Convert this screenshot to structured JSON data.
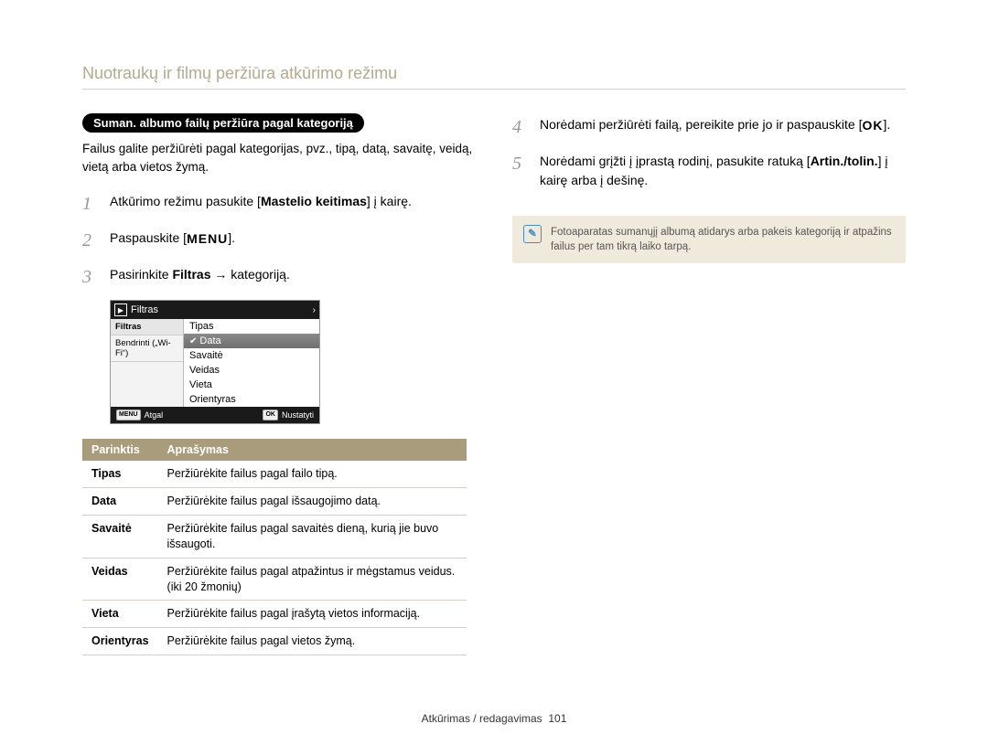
{
  "page_title": "Nuotraukų ir filmų peržiūra atkūrimo režimu",
  "pill": "Suman. albumo failų peržiūra pagal kategoriją",
  "intro": "Failus galite peržiūrėti pagal kategorijas, pvz., tipą, datą, savaitę, veidą, vietą arba vietos žymą.",
  "steps_left": {
    "s1_pre": "Atkūrimo režimu pasukite [",
    "s1_bold": "Mastelio keitimas",
    "s1_post": "] į kairę.",
    "s2_pre": "Paspauskite [",
    "s2_label": "MENU",
    "s2_post": "].",
    "s3_pre": "Pasirinkite ",
    "s3_bold": "Filtras",
    "s3_post": " → kategoriją."
  },
  "steps_right": {
    "s4_pre": "Norėdami peržiūrėti failą, pereikite prie jo ir paspauskite [",
    "s4_label": "OK",
    "s4_post": "].",
    "s5_pre": "Norėdami grįžti į įprastą rodinį, pasukite ratuką [",
    "s5_bold": "Artin./tolin.",
    "s5_post": "] į kairę arba į dešinę."
  },
  "device": {
    "top_label": "Filtras",
    "left_tab1": "Filtras",
    "left_tab2": "Bendrinti („Wi-Fi“)",
    "items": [
      "Tipas",
      "Data",
      "Savaitė",
      "Veidas",
      "Vieta",
      "Orientyras"
    ],
    "selected_index": 1,
    "back_key": "MENU",
    "back_label": "Atgal",
    "set_key": "OK",
    "set_label": "Nustatyti"
  },
  "table": {
    "h1": "Parinktis",
    "h2": "Aprašymas",
    "rows": [
      {
        "k": "Tipas",
        "v": "Peržiūrėkite failus pagal failo tipą."
      },
      {
        "k": "Data",
        "v": "Peržiūrėkite failus pagal išsaugojimo datą."
      },
      {
        "k": "Savaitė",
        "v": "Peržiūrėkite failus pagal savaitės dieną, kurią jie buvo išsaugoti."
      },
      {
        "k": "Veidas",
        "v": "Peržiūrėkite failus pagal atpažintus ir mėgstamus veidus. (iki 20 žmonių)"
      },
      {
        "k": "Vieta",
        "v": "Peržiūrėkite failus pagal įrašytą vietos informaciją."
      },
      {
        "k": "Orientyras",
        "v": "Peržiūrėkite failus pagal vietos žymą."
      }
    ]
  },
  "note": "Fotoaparatas sumanųjį albumą atidarys arba pakeis kategoriją ir atpažins failus per tam tikrą laiko tarpą.",
  "footer_text": "Atkūrimas / redagavimas",
  "footer_page": "101"
}
